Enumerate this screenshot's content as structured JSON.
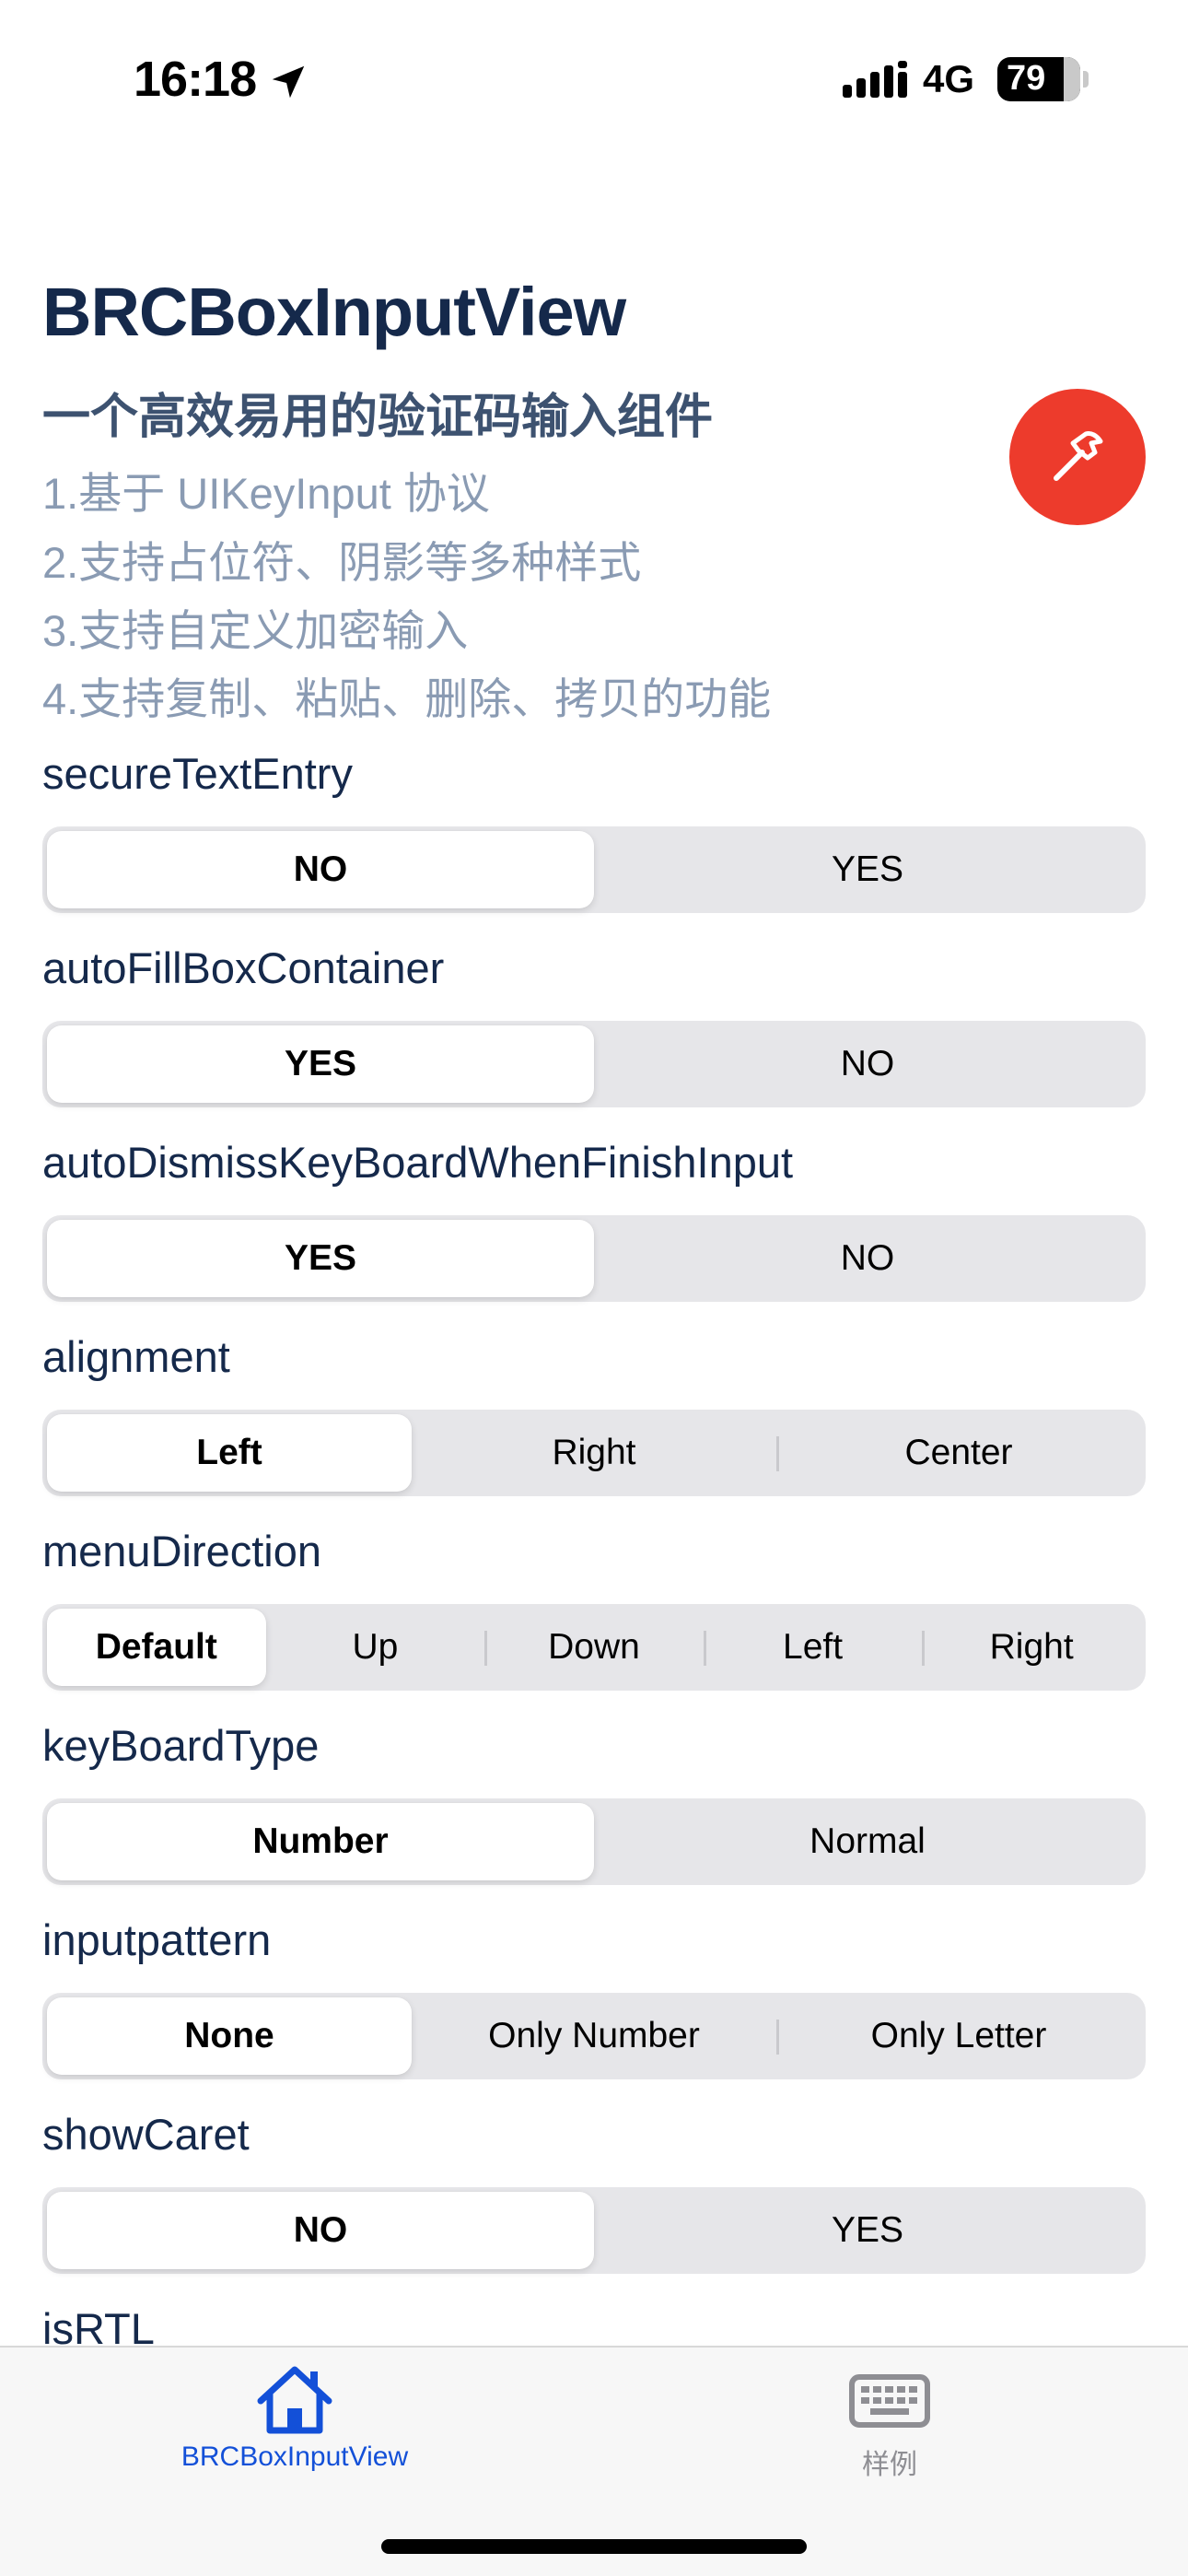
{
  "status_bar": {
    "time": "16:18",
    "network": "4G",
    "battery": "79",
    "icons": [
      "location-arrow-icon",
      "signal-bars-icon",
      "battery-icon"
    ]
  },
  "header": {
    "title": "BRCBoxInputView",
    "subtitle": "一个高效易用的验证码输入组件",
    "features": [
      "1.基于 UIKeyInput 协议",
      "2.支持占位符、阴影等多种样式",
      "3.支持自定义加密输入",
      "4.支持复制、粘贴、删除、拷贝的功能"
    ],
    "fab_icon": "hammer-icon"
  },
  "options": [
    {
      "label": "secureTextEntry",
      "segments": [
        "NO",
        "YES"
      ],
      "selected": 0
    },
    {
      "label": "autoFillBoxContainer",
      "segments": [
        "YES",
        "NO"
      ],
      "selected": 0
    },
    {
      "label": "autoDismissKeyBoardWhenFinishInput",
      "segments": [
        "YES",
        "NO"
      ],
      "selected": 0
    },
    {
      "label": "alignment",
      "segments": [
        "Left",
        "Right",
        "Center"
      ],
      "selected": 0
    },
    {
      "label": "menuDirection",
      "segments": [
        "Default",
        "Up",
        "Down",
        "Left",
        "Right"
      ],
      "selected": 0
    },
    {
      "label": "keyBoardType",
      "segments": [
        "Number",
        "Normal"
      ],
      "selected": 0
    },
    {
      "label": "inputpattern",
      "segments": [
        "None",
        "Only Number",
        "Only Letter"
      ],
      "selected": 0
    },
    {
      "label": "showCaret",
      "segments": [
        "NO",
        "YES"
      ],
      "selected": 0
    },
    {
      "label": "isRTL"
    }
  ],
  "tab_bar": {
    "items": [
      {
        "label": "BRCBoxInputView",
        "icon": "house-icon",
        "active": true
      },
      {
        "label": "样例",
        "icon": "keyboard-icon",
        "active": false
      }
    ]
  },
  "colors": {
    "accent": "#1350d8",
    "fab": "#ed3b2c",
    "title": "#15294b",
    "feature_text": "#8a9bb3",
    "segment_track": "#e6e6e9",
    "tab_inactive": "#8e8e93"
  }
}
